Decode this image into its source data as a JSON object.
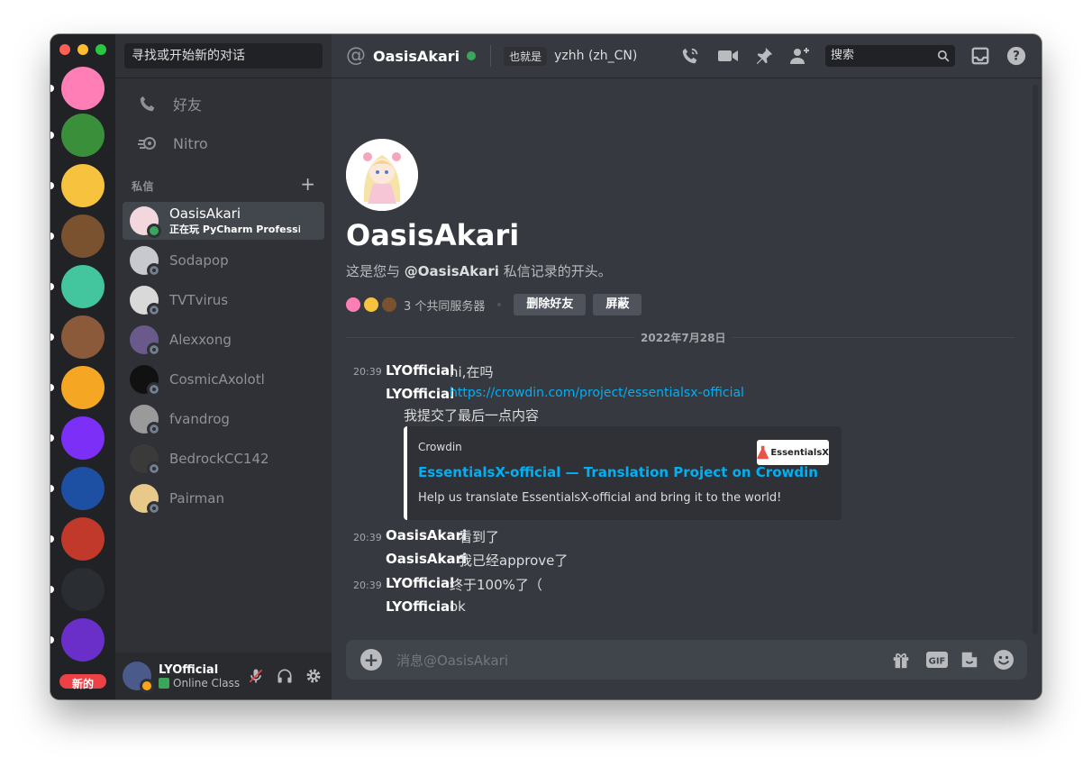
{
  "sidebar": {
    "search_placeholder": "寻找或开始新的对话",
    "nav": [
      {
        "label": "好友",
        "icon": "friends-icon"
      },
      {
        "label": "Nitro",
        "icon": "nitro-icon"
      }
    ],
    "dm_header": "私信",
    "dms": [
      {
        "name": "OasisAkari",
        "activity": "正在玩 PyCharm Professio...",
        "status": "online",
        "active": true,
        "color": "#f3d7df"
      },
      {
        "name": "Sodapop",
        "status": "offline",
        "color": "#c7c9cf"
      },
      {
        "name": "TVTvirus",
        "status": "offline",
        "color": "#d9d9d9"
      },
      {
        "name": "Alexxong",
        "status": "offline",
        "color": "#6a5a8c"
      },
      {
        "name": "CosmicAxolotl",
        "status": "offline",
        "color": "#111111"
      },
      {
        "name": "fvandrog",
        "status": "offline",
        "color": "#9a9a9a"
      },
      {
        "name": "BedrockCC142",
        "status": "offline",
        "color": "#3a3a3a"
      },
      {
        "name": "Pairman",
        "status": "offline",
        "color": "#e8c98a"
      }
    ],
    "user": {
      "name": "LYOfficial",
      "status": "Online Class"
    }
  },
  "rail": {
    "new_badge": "新的",
    "servers": [
      {
        "name": "server-pride-flask",
        "color": "#ff7eb6"
      },
      {
        "name": "server-globe-chat",
        "color": "#3a8f3a"
      },
      {
        "name": "server-rainbow-cube",
        "color": "#f7c23e"
      },
      {
        "name": "server-cookie",
        "color": "#7a5230"
      },
      {
        "name": "server-green-badge",
        "color": "#43c59e"
      },
      {
        "name": "server-mtdr",
        "color": "#8a5a3a"
      },
      {
        "name": "server-tmc",
        "color": "#f5a623"
      },
      {
        "name": "server-mw",
        "color": "#7b2ff7"
      },
      {
        "name": "server-blue-ring",
        "color": "#1d4fa3"
      },
      {
        "name": "server-aperture",
        "color": "#c0392b"
      },
      {
        "name": "server-tis",
        "color": "#2a2d31"
      },
      {
        "name": "server-ht",
        "color": "#6a2fc9"
      }
    ]
  },
  "topbar": {
    "name": "OasisAkari",
    "aka_label": "也就是",
    "nickname": "yzhh (zh_CN)",
    "search_placeholder": "搜索"
  },
  "intro": {
    "name": "OasisAkari",
    "desc_prefix": "这是您与",
    "desc_mention": "@OasisAkari",
    "desc_suffix": "私信记录的开头。",
    "mutual_servers": "3 个共同服务器",
    "remove_friend": "删除好友",
    "block": "屏蔽"
  },
  "date_divider": "2022年7月28日",
  "messages": [
    {
      "time": "20:39",
      "author": "LYOfficial",
      "text": "hi,在吗"
    },
    {
      "author": "LYOfficial",
      "link": "https://crowdin.com/project/essentialsx-official",
      "text2": "我提交了最后一点内容"
    },
    {
      "time": "20:39",
      "author": "OasisAkari",
      "text": "看到了"
    },
    {
      "author": "OasisAkari",
      "text": "我已经approve了"
    },
    {
      "time": "20:39",
      "author": "LYOfficial",
      "text": "终于100%了（"
    },
    {
      "author": "LYOfficial",
      "text": "ok"
    }
  ],
  "embed": {
    "provider": "Crowdin",
    "title": "EssentialsX-official — Translation Project on Crowdin",
    "description": "Help us translate EssentialsX-official and bring it to the world!",
    "thumb_text": "EssentialsX"
  },
  "composer": {
    "placeholder": "消息@OasisAkari"
  }
}
